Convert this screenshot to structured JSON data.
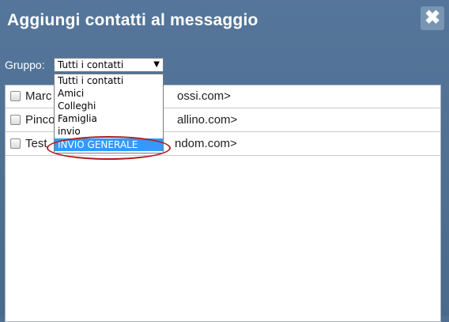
{
  "dialog": {
    "title": "Aggiungi contatti al messaggio",
    "close_glyph": "✖"
  },
  "group": {
    "label": "Gruppo:",
    "selected": "Tutti i contatti",
    "arrow": "▼",
    "options": [
      "Tutti i contatti",
      "Amici",
      "Colleghi",
      "Famiglia",
      "invio",
      "INVIO GENERALE"
    ],
    "highlighted": "INVIO GENERALE"
  },
  "contacts": [
    {
      "left_text": "Marc",
      "right_text": "ossi.com>",
      "checked": false
    },
    {
      "left_text": "Pinco",
      "right_text": "allino.com>",
      "checked": false
    },
    {
      "left_text": "Test",
      "right_text": "ndom.com>",
      "checked": false
    }
  ],
  "colors": {
    "header_bg": "#4e6f91",
    "highlight": "#3399ff",
    "annotation": "#b01d1d"
  }
}
